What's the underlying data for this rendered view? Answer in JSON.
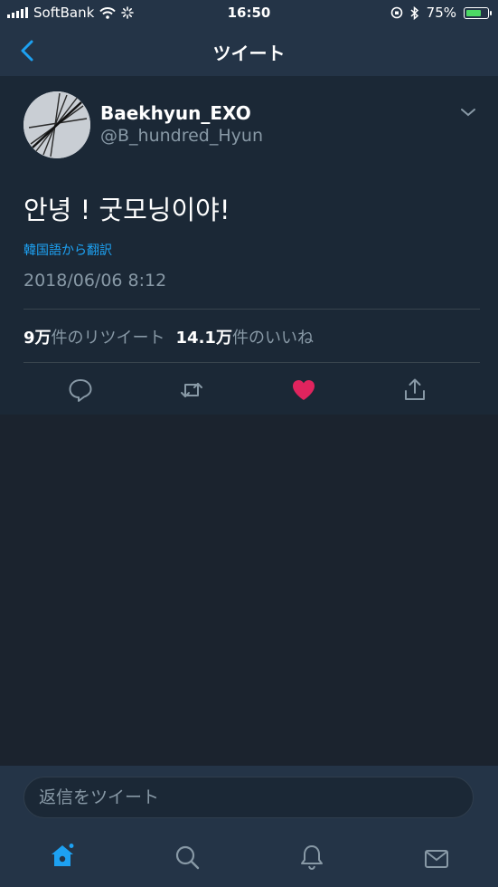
{
  "status_bar": {
    "carrier": "SoftBank",
    "time": "16:50",
    "battery_percent": "75%",
    "battery_level": 0.75,
    "battery_color": "#4cd964"
  },
  "nav": {
    "title": "ツイート",
    "back_icon": "chevron-left-icon"
  },
  "tweet": {
    "display_name": "Baekhyun_EXO",
    "handle": "@B_hundred_Hyun",
    "text": "안녕 ! 굿모닝이야!",
    "translate_link": "韓国語から翻訳",
    "timestamp": "2018/06/06 8:12",
    "retweet_count": "9万",
    "retweet_label": "件のリツイート",
    "like_count": "14.1万",
    "like_label": "件のいいね",
    "liked": true,
    "like_color": "#e0245e",
    "actions": [
      "reply-icon",
      "retweet-icon",
      "heart-icon",
      "share-icon"
    ]
  },
  "reply": {
    "placeholder": "返信をツイート"
  },
  "tab_bar": {
    "items": [
      "home-icon",
      "search-icon",
      "notifications-icon",
      "messages-icon"
    ],
    "active": "home-icon",
    "accent": "#1da1f2"
  }
}
